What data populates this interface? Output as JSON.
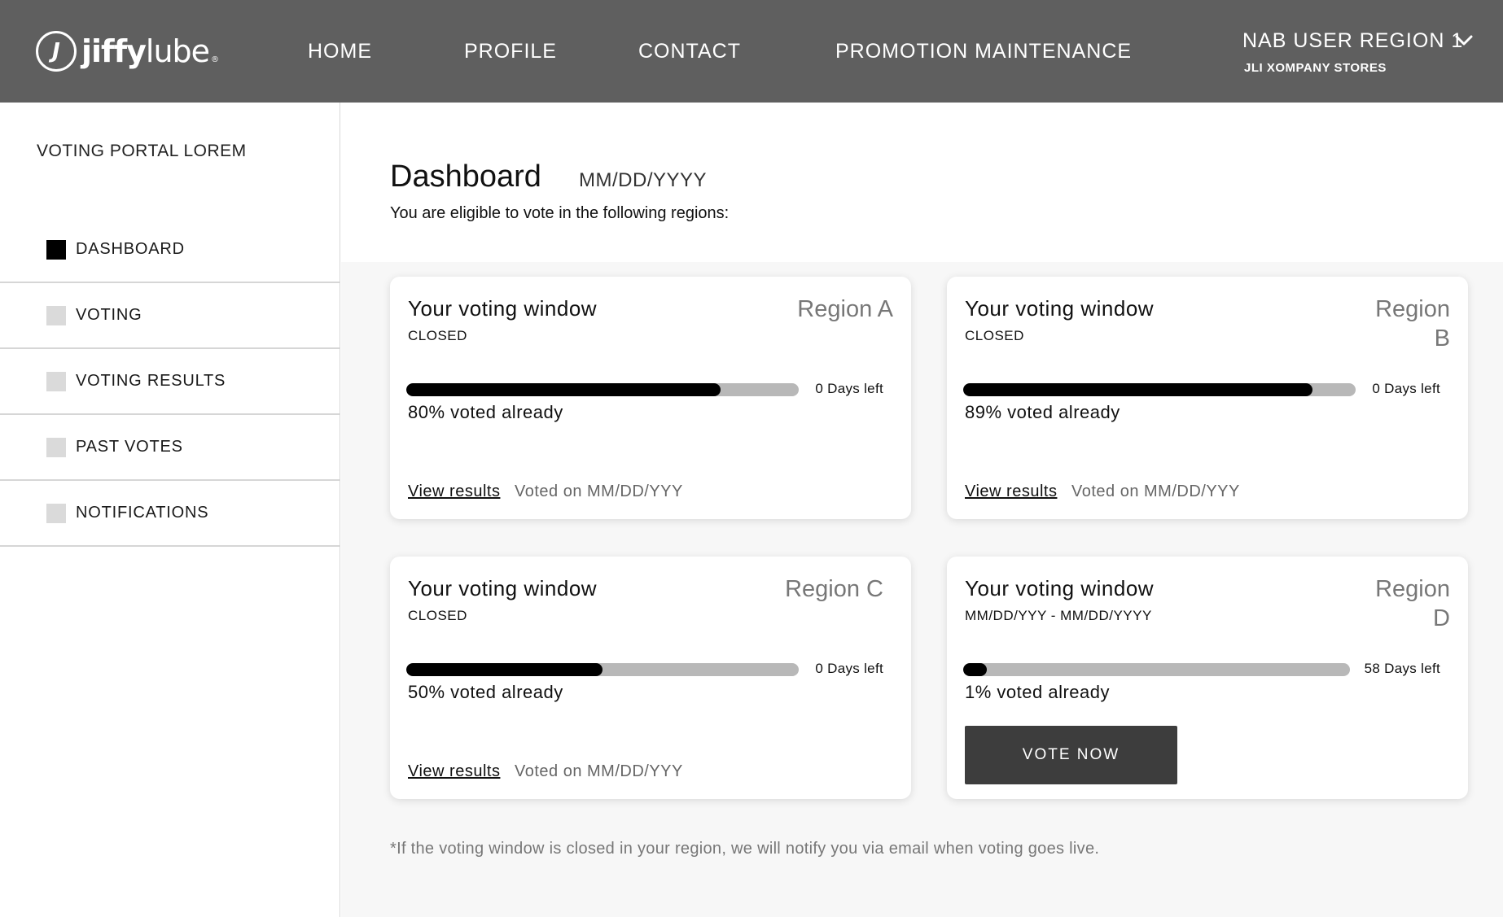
{
  "brand": {
    "mark": "J",
    "word_bold": "jiffy",
    "word_regular": "lube",
    "tm": "®"
  },
  "nav": {
    "home": "HOME",
    "profile": "PROFILE",
    "contact": "CONTACT",
    "promotion": "PROMOTION MAINTENANCE"
  },
  "user": {
    "name": "NAB USER REGION 1",
    "org": "JLI XOMPANY STORES"
  },
  "sidebar": {
    "title": "VOTING PORTAL LOREM",
    "items": [
      {
        "label": "DASHBOARD",
        "active": true
      },
      {
        "label": "VOTING",
        "active": false
      },
      {
        "label": "VOTING RESULTS",
        "active": false
      },
      {
        "label": "PAST VOTES",
        "active": false
      },
      {
        "label": "NOTIFICATIONS",
        "active": false
      }
    ]
  },
  "page": {
    "title": "Dashboard",
    "date": "MM/DD/YYYY",
    "subtitle": "You are eligible to vote in the following regions:"
  },
  "cards": [
    {
      "title": "Your voting window",
      "status": "CLOSED",
      "region": "Region A",
      "progress": 0.8,
      "days_left": "0 Days left",
      "voted_text": "80% voted already",
      "link": "View results",
      "voted_on": "Voted on MM/DD/YYY"
    },
    {
      "title": "Your voting window",
      "status": "CLOSED",
      "region": "Region B",
      "progress": 0.89,
      "days_left": "0 Days left",
      "voted_text": "89% voted already",
      "link": "View results",
      "voted_on": "Voted on MM/DD/YYY"
    },
    {
      "title": "Your voting window",
      "status": "CLOSED",
      "region": "Region C",
      "progress": 0.5,
      "days_left": "0 Days left",
      "voted_text": "50% voted already",
      "link": "View results",
      "voted_on": "Voted on MM/DD/YYY"
    },
    {
      "title": "Your voting window",
      "status": "MM/DD/YYY - MM/DD/YYYY",
      "region": "Region D",
      "progress": 0.01,
      "days_left": "58 Days left",
      "voted_text": "1% voted already",
      "button": "VOTE NOW"
    }
  ],
  "footnote": "*If the voting window is closed in your region, we will notify you via email when voting goes live.",
  "colors": {
    "header_bg": "#5f5f5f",
    "bar_fill": "#000000",
    "bar_track": "#b8b8b8",
    "button_bg": "#3d3d3d"
  }
}
